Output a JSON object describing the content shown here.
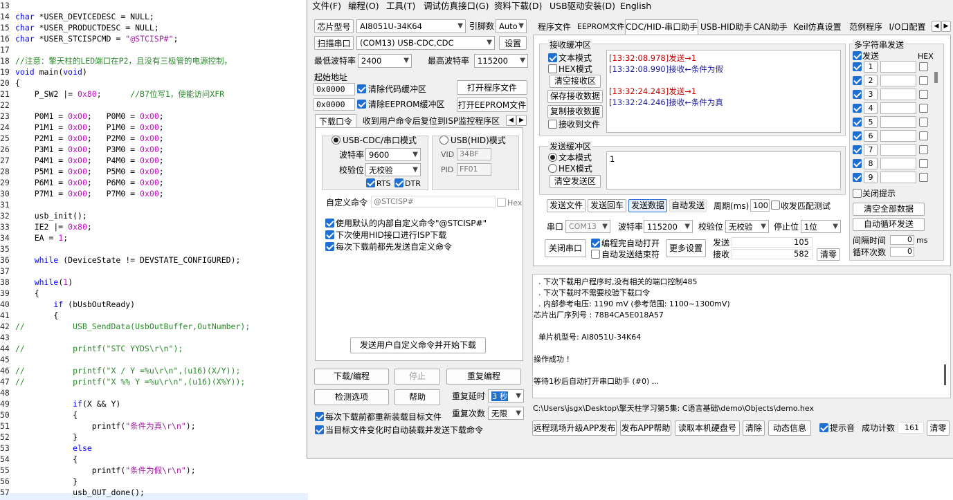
{
  "editor": {
    "lines": [
      {
        "num": "13",
        "text": ""
      },
      {
        "num": "14",
        "text": "char *USER_DEVICEDESC = NULL;"
      },
      {
        "num": "15",
        "text": "char *USER_PRODUCTDESC = NULL;"
      },
      {
        "num": "16",
        "text": "char *USER_STCISPCMD = \"@STCISP#\";"
      },
      {
        "num": "17",
        "text": ""
      },
      {
        "num": "18",
        "text": "//注意：擎天柱的LED端口在P2，且没有三极管的电源控制，"
      },
      {
        "num": "19",
        "text": "void main(void)"
      },
      {
        "num": "20",
        "text": "{"
      },
      {
        "num": "21",
        "text": "    P_SW2 |= 0x80;      //B7位写1，使能访问XFR"
      },
      {
        "num": "22",
        "text": ""
      },
      {
        "num": "23",
        "text": "    P0M1 = 0x00;   P0M0 = 0x00;"
      },
      {
        "num": "24",
        "text": "    P1M1 = 0x00;   P1M0 = 0x00;"
      },
      {
        "num": "25",
        "text": "    P2M1 = 0x00;   P2M0 = 0x00;"
      },
      {
        "num": "26",
        "text": "    P3M1 = 0x00;   P3M0 = 0x00;"
      },
      {
        "num": "27",
        "text": "    P4M1 = 0x00;   P4M0 = 0x00;"
      },
      {
        "num": "28",
        "text": "    P5M1 = 0x00;   P5M0 = 0x00;"
      },
      {
        "num": "29",
        "text": "    P6M1 = 0x00;   P6M0 = 0x00;"
      },
      {
        "num": "30",
        "text": "    P7M1 = 0x00;   P7M0 = 0x00;"
      },
      {
        "num": "31",
        "text": ""
      },
      {
        "num": "32",
        "text": "    usb_init();"
      },
      {
        "num": "33",
        "text": "    IE2 |= 0x80;"
      },
      {
        "num": "34",
        "text": "    EA = 1;"
      },
      {
        "num": "35",
        "text": ""
      },
      {
        "num": "36",
        "text": "    while (DeviceState != DEVSTATE_CONFIGURED);"
      },
      {
        "num": "37",
        "text": ""
      },
      {
        "num": "38",
        "text": "    while(1)"
      },
      {
        "num": "39",
        "text": "    {"
      },
      {
        "num": "40",
        "text": "        if (bUsbOutReady)"
      },
      {
        "num": "41",
        "text": "        {"
      },
      {
        "num": "42",
        "text": "//          USB_SendData(UsbOutBuffer,OutNumber);"
      },
      {
        "num": "43",
        "text": ""
      },
      {
        "num": "44",
        "text": "//          printf(\"STC YYDS\\r\\n\");"
      },
      {
        "num": "45",
        "text": ""
      },
      {
        "num": "46",
        "text": "//          printf(\"X / Y =%u\\r\\n\",(u16)(X/Y));"
      },
      {
        "num": "47",
        "text": "//          printf(\"X %% Y =%u\\r\\n\",(u16)(X%Y));"
      },
      {
        "num": "48",
        "text": ""
      },
      {
        "num": "49",
        "text": "            if(X && Y)"
      },
      {
        "num": "50",
        "text": "            {"
      },
      {
        "num": "51",
        "text": "                printf(\"条件为真\\r\\n\");"
      },
      {
        "num": "52",
        "text": "            }"
      },
      {
        "num": "53",
        "text": "            else"
      },
      {
        "num": "54",
        "text": "            {"
      },
      {
        "num": "55",
        "text": "                printf(\"条件为假\\r\\n\");"
      },
      {
        "num": "56",
        "text": "            }"
      },
      {
        "num": "57",
        "text": "            usb_OUT_done();"
      }
    ]
  },
  "menu": [
    "文件(F)",
    "编程(O)",
    "工具(T)",
    "调试仿真接口(G)",
    "资料下载(D)",
    "USB驱动安装(D)",
    "English"
  ],
  "left": {
    "chip_label": "芯片型号",
    "chip_value": "AI8051U-34K64",
    "pin_label": "引脚数",
    "pin_value": "Auto",
    "scan_button": "扫描串口",
    "port_value": "(COM13) USB-CDC,CDC",
    "settings_button": "设置",
    "min_baud_label": "最低波特率",
    "min_baud_value": "2400",
    "max_baud_label": "最高波特率",
    "max_baud_value": "115200",
    "start_addr_label": "起始地址",
    "addr1": "0x0000",
    "clear_code_label": "清除代码缓冲区",
    "open_prog_button": "打开程序文件",
    "addr2": "0x0000",
    "clear_eeprom_label": "清除EEPROM缓冲区",
    "open_eeprom_button": "打开EEPROM文件",
    "tabs": [
      "下载口令",
      "收到用户命令后复位到ISP监控程序区"
    ],
    "cdc_mode": "USB-CDC/串口模式",
    "hid_mode": "USB(HID)模式",
    "baud_label": "波特率",
    "baud_value": "9600",
    "parity_label": "校验位",
    "parity_value": "无校验",
    "rts": "RTS",
    "dtr": "DTR",
    "vid_label": "VID",
    "vid_value": "34BF",
    "pid_label": "PID",
    "pid_value": "FF01",
    "custom_cmd_label": "自定义命令",
    "custom_cmd_value": "@STCISP#",
    "hex_label": "Hex",
    "opt1": "使用默认的内部自定义命令\"@STCISP#\"",
    "opt2": "下次使用HID接口进行ISP下载",
    "opt3": "每次下载前都先发送自定义命令",
    "send_custom_button": "发送用户自定义命令并开始下载",
    "download_button": "下载/编程",
    "stop_button": "停止",
    "reprogram_button": "重复编程",
    "check_button": "检测选项",
    "help_button": "帮助",
    "delay_label": "重复延时",
    "delay_value": "3 秒",
    "count_label": "重复次数",
    "count_value": "无限",
    "reload_label": "每次下载前都重新装载目标文件",
    "autoload_label": "当目标文件变化时自动装载并发送下载命令"
  },
  "right": {
    "tabs": [
      "程序文件",
      "EEPROM文件",
      "CDC/HID-串口助手",
      "USB-HID助手",
      "CAN助手",
      "Keil仿真设置",
      "范例程序",
      "I/O口配置"
    ],
    "recv_title": "接收缓冲区",
    "text_mode": "文本模式",
    "hex_mode": "HEX模式",
    "clear_recv_button": "清空接收区",
    "save_recv_button": "保存接收数据",
    "copy_recv_button": "复制接收数据",
    "recv_to_file": "接收到文件",
    "recv_lines": [
      {
        "text": "[13:32:08.978]发送→1",
        "color": "#c00000"
      },
      {
        "text": "[13:32:08.990]接收←条件为假",
        "color": "#1e1ea0"
      },
      {
        "text": "",
        "color": "#000"
      },
      {
        "text": "[13:32:24.243]发送→1",
        "color": "#c00000"
      },
      {
        "text": "[13:32:24.246]接收←条件为真",
        "color": "#1e1ea0"
      }
    ],
    "send_title": "发送缓冲区",
    "send_text_mode": "文本模式",
    "send_hex_mode": "HEX模式",
    "clear_send_button": "清空发送区",
    "send_value": "1",
    "send_file_button": "发送文件",
    "send_return_button": "发送回车",
    "send_data_button": "发送数据",
    "auto_send_label": "自动发送",
    "period_label": "周期(ms)",
    "period_value": "100",
    "match_label": "收发匹配测试",
    "port_label": "串口",
    "port_value": "COM13",
    "baud_label": "波特率",
    "baud_value": "115200",
    "parity_label": "校验位",
    "parity_value": "无校验",
    "stop_label": "停止位",
    "stop_value": "1位",
    "close_port_button": "关闭串口",
    "auto_open_label": "编程完自动打开",
    "auto_end_label": "自动发送结束符",
    "more_button": "更多设置",
    "sent_label": "发送",
    "sent_value": "105",
    "recv_label": "接收",
    "recv_value": "582",
    "clear_button": "清零",
    "multi_title": "多字符串发送",
    "multi_send_label": "发送",
    "multi_hex_label": "HEX",
    "multi_rows": [
      "1",
      "2",
      "3",
      "4",
      "5",
      "6",
      "7",
      "8",
      "9"
    ],
    "close_tip_label": "关闭提示",
    "clear_all_button": "清空全部数据",
    "auto_loop_button": "自动循环发送",
    "interval_label": "间隔时间",
    "interval_value": "0",
    "interval_unit": "ms",
    "loop_label": "循环次数",
    "loop_value": "0",
    "log_lines": [
      "  . 下次下载用户程序时,没有相关的端口控制485",
      "  . 下次下载时不需要校验下载口令",
      "  . 内部参考电压: 1190 mV (参考范围: 1100~1300mV)",
      "芯片出厂序列号 : 78B4CA5E018A57",
      "",
      "  单片机型号: AI8051U-34K64",
      "",
      "操作成功 !",
      "",
      "等待1秒后自动打开串口助手 (#0) ..."
    ],
    "path": "C:\\Users\\jsgx\\Desktop\\擎天柱学习第5集: C语言基础\\demo\\Objects\\demo.hex",
    "bottom": {
      "remote_button": "远程现场升级APP发布",
      "publish_help_button": "发布APP帮助",
      "read_disk_button": "读取本机硬盘号",
      "clear_button": "清除",
      "dynamic_button": "动态信息",
      "sound_label": "提示音",
      "success_label": "成功计数",
      "success_value": "161",
      "clear_count_button": "清零"
    }
  }
}
